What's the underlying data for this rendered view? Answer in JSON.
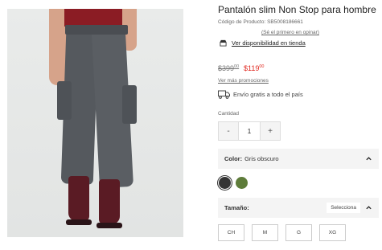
{
  "product": {
    "title": "Pantalón slim Non Stop para hombre",
    "sku": "Código de Producto: SB5008186661",
    "review_link": "(Sé el primero en opinar)",
    "availability_link": "Ver disponibilidad en tienda",
    "price_old_main": "$399",
    "price_old_cents": "00",
    "price_new_main": "$119",
    "price_new_cents": "00",
    "promos_link": "Ver más promociones",
    "shipping": "Envío gratis a todo el país"
  },
  "quantity": {
    "label": "Cantidad",
    "minus": "-",
    "value": "1",
    "plus": "+"
  },
  "color": {
    "label": "Color:",
    "selected": "Gris obscuro",
    "swatches": [
      "#343434",
      "#5e7c3a"
    ]
  },
  "size": {
    "label": "Tamaño:",
    "select_text": "Selecciona",
    "options": [
      "CH",
      "M",
      "G",
      "XG"
    ]
  },
  "icons": [
    "store-icon",
    "truck-icon",
    "chevron-up-icon"
  ],
  "colors": {
    "sale_price": "#e0261d"
  }
}
